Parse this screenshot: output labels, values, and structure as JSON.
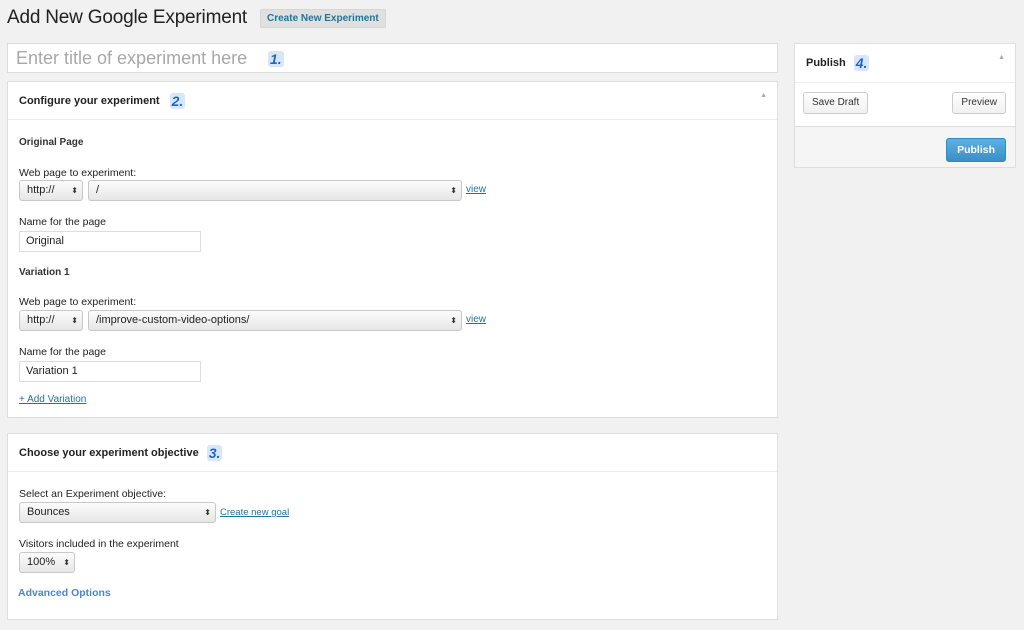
{
  "header": {
    "title": "Add New Google Experiment",
    "create_button": "Create New Experiment"
  },
  "title_field": {
    "placeholder": "Enter title of experiment here",
    "value": ""
  },
  "badges": {
    "one": "1.",
    "two": "2.",
    "three": "3.",
    "four": "4."
  },
  "configure": {
    "heading": "Configure your experiment",
    "original": {
      "section": "Original Page",
      "web_label": "Web page to experiment:",
      "protocol": "http://",
      "path": "/",
      "view": "view",
      "name_label": "Name for the page",
      "name_value": "Original"
    },
    "variation": {
      "section": "Variation 1",
      "web_label": "Web page to experiment:",
      "protocol": "http://",
      "path": "/improve-custom-video-options/",
      "view": "view",
      "name_label": "Name for the page",
      "name_value": "Variation 1"
    },
    "add_variation": "+ Add Variation"
  },
  "objective": {
    "heading": "Choose your experiment objective",
    "select_label": "Select an Experiment objective:",
    "selected": "Bounces",
    "create_goal": "Create new goal",
    "visitors_label": "Visitors included in the experiment",
    "visitors_value": "100%",
    "advanced": "Advanced Options"
  },
  "publish": {
    "heading": "Publish",
    "save_draft": "Save Draft",
    "preview": "Preview",
    "publish": "Publish"
  },
  "icons": {
    "select_arrows": "⬍",
    "collapse": "▲"
  }
}
